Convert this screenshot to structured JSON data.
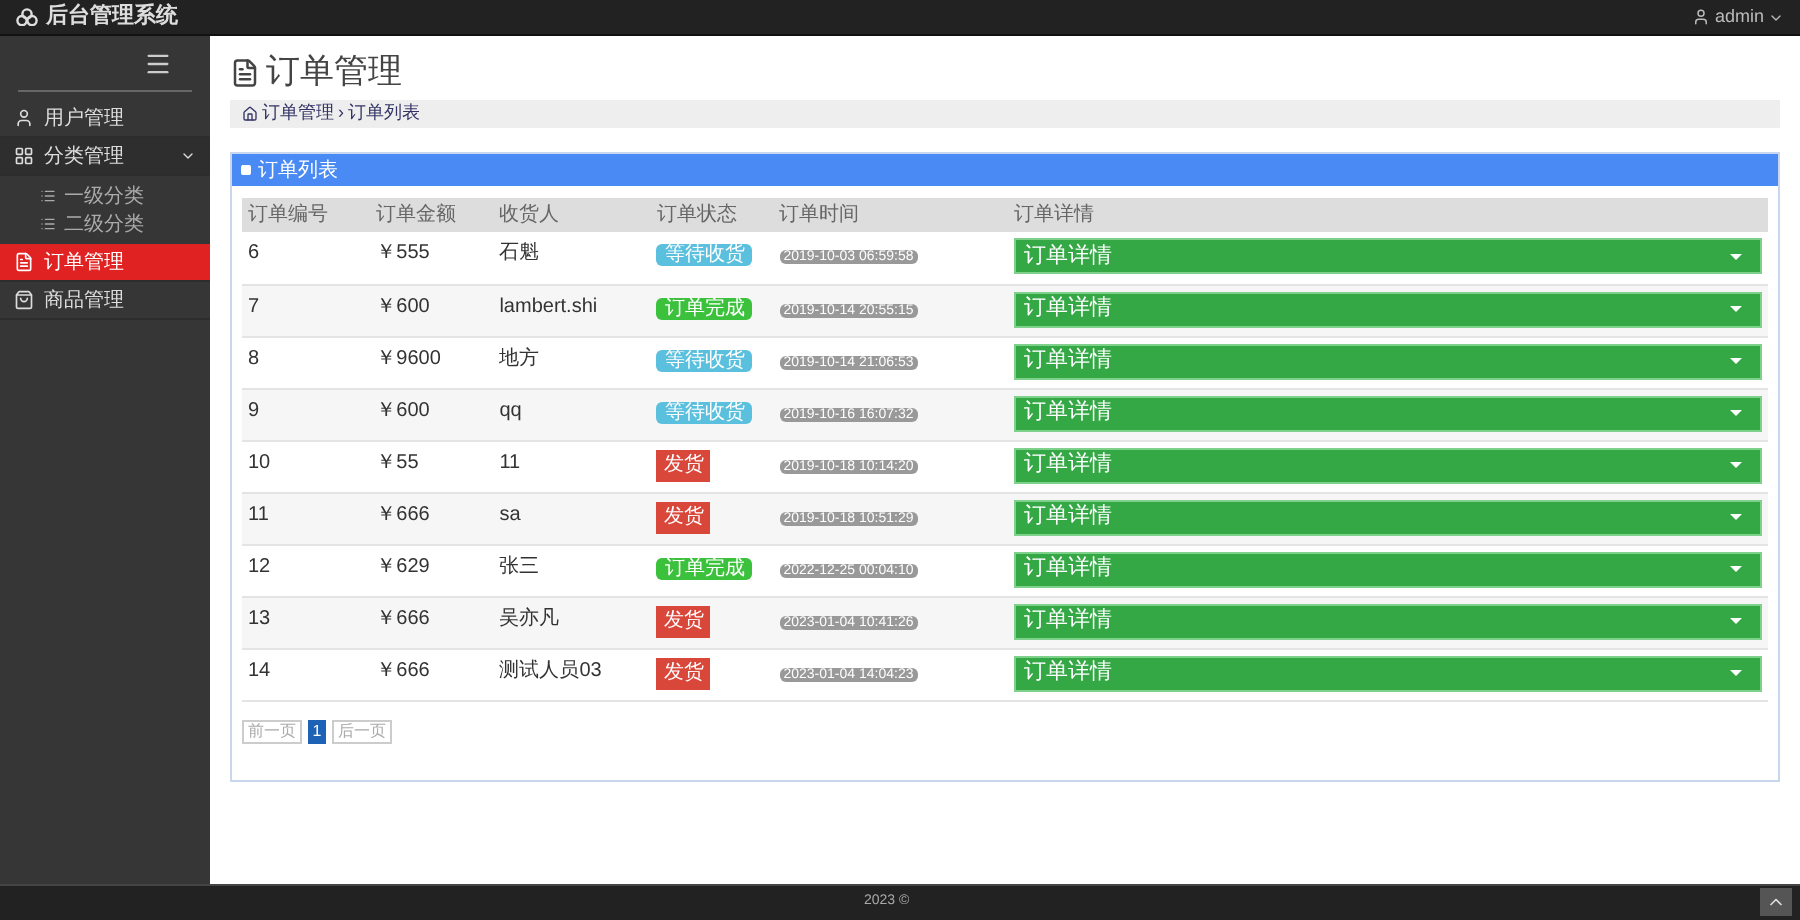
{
  "header": {
    "brand": "后台管理系统",
    "user": "admin"
  },
  "sidebar": {
    "items": [
      {
        "label": "用户管理",
        "kind": "user",
        "selected": false
      },
      {
        "label": "分类管理",
        "kind": "grid",
        "selected": false,
        "expanded": true,
        "children": [
          {
            "label": "一级分类"
          },
          {
            "label": "二级分类"
          }
        ]
      },
      {
        "label": "订单管理",
        "kind": "file",
        "selected": true
      },
      {
        "label": "商品管理",
        "kind": "shop",
        "selected": false
      }
    ]
  },
  "page_title": "订单管理",
  "breadcrumb": {
    "separator": "›",
    "items": [
      "订单管理",
      "订单列表"
    ]
  },
  "panel_title": "订单列表",
  "table": {
    "columns": [
      "订单编号",
      "订单金额",
      "收货人",
      "订单状态",
      "订单时间",
      "订单详情"
    ],
    "rows": [
      {
        "id": "6",
        "amount": "￥555",
        "receiver": "石魁",
        "status": {
          "kind": "waiting",
          "label": "等待收货"
        },
        "time": "2019-10-03 06:59:58",
        "detail": "订单详情"
      },
      {
        "id": "7",
        "amount": "￥600",
        "receiver": "lambert.shi",
        "status": {
          "kind": "done",
          "label": "订单完成"
        },
        "time": "2019-10-14 20:55:15",
        "detail": "订单详情"
      },
      {
        "id": "8",
        "amount": "￥9600",
        "receiver": "地方",
        "status": {
          "kind": "waiting",
          "label": "等待收货"
        },
        "time": "2019-10-14 21:06:53",
        "detail": "订单详情"
      },
      {
        "id": "9",
        "amount": "￥600",
        "receiver": "qq",
        "status": {
          "kind": "waiting",
          "label": "等待收货"
        },
        "time": "2019-10-16 16:07:32",
        "detail": "订单详情"
      },
      {
        "id": "10",
        "amount": "￥55",
        "receiver": "11",
        "status": {
          "kind": "ship",
          "label": "发货"
        },
        "time": "2019-10-18 10:14:20",
        "detail": "订单详情"
      },
      {
        "id": "11",
        "amount": "￥666",
        "receiver": "sa",
        "status": {
          "kind": "ship",
          "label": "发货"
        },
        "time": "2019-10-18 10:51:29",
        "detail": "订单详情"
      },
      {
        "id": "12",
        "amount": "￥629",
        "receiver": "张三",
        "status": {
          "kind": "done",
          "label": "订单完成"
        },
        "time": "2022-12-25 00:04:10",
        "detail": "订单详情"
      },
      {
        "id": "13",
        "amount": "￥666",
        "receiver": "吴亦凡",
        "status": {
          "kind": "ship",
          "label": "发货"
        },
        "time": "2023-01-04 10:41:26",
        "detail": "订单详情"
      },
      {
        "id": "14",
        "amount": "￥666",
        "receiver": "测试人员03",
        "status": {
          "kind": "ship",
          "label": "发货"
        },
        "time": "2023-01-04 14:04:23",
        "detail": "订单详情"
      }
    ]
  },
  "pagination": {
    "prev": "前一页",
    "pages": [
      {
        "label": "1",
        "selected": true
      }
    ],
    "next": "后一页"
  },
  "footer": "2023 ©"
}
